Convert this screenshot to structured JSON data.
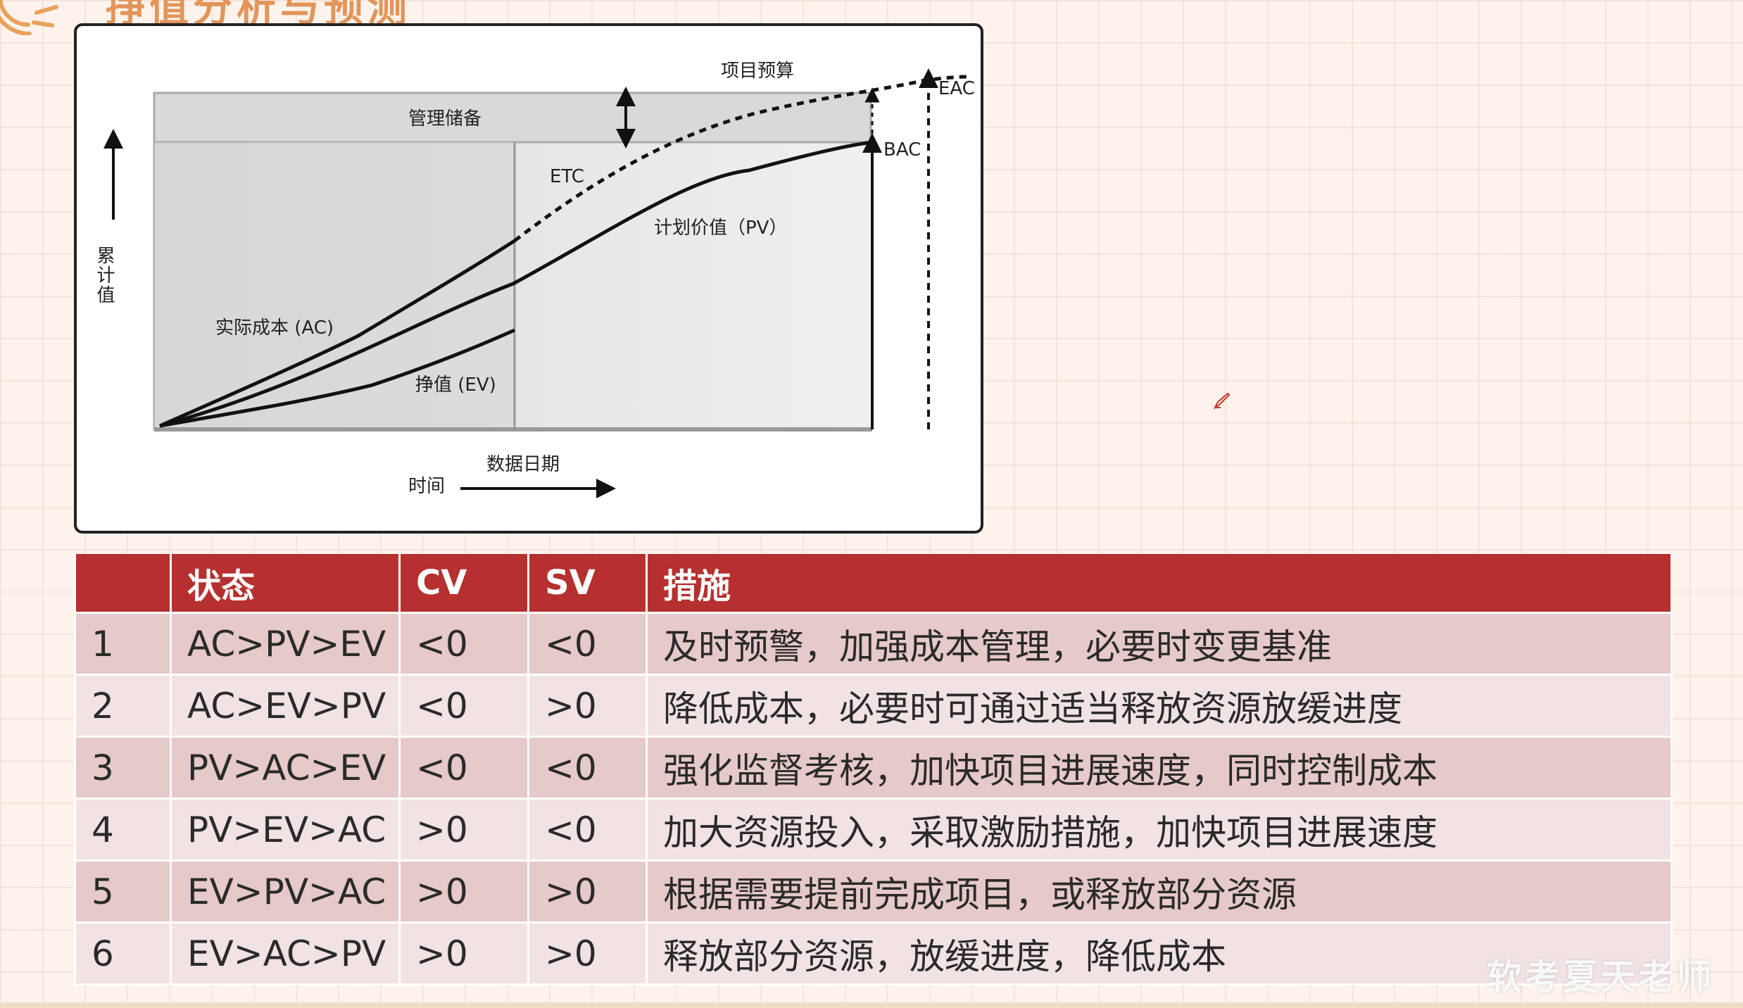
{
  "slide": {
    "title_fragment": "挣值分析与预测",
    "watermark": "软考夏天老师"
  },
  "diagram": {
    "labels": {
      "project_budget": "项目预算",
      "management_reserve": "管理储备",
      "eac": "EAC",
      "bac": "BAC",
      "etc": "ETC",
      "pv": "计划价值（PV）",
      "ac": "实际成本 (AC)",
      "ev": "挣值 (EV)",
      "y_axis": "累计值",
      "time": "时间",
      "data_date": "数据日期"
    }
  },
  "table": {
    "headers": [
      "",
      "状态",
      "CV",
      "SV",
      "措施"
    ],
    "rows": [
      [
        "1",
        "AC>PV>EV",
        "<0",
        "<0",
        "及时预警，加强成本管理，必要时变更基准"
      ],
      [
        "2",
        "AC>EV>PV",
        "<0",
        ">0",
        "降低成本，必要时可通过适当释放资源放缓进度"
      ],
      [
        "3",
        "PV>AC>EV",
        "<0",
        "<0",
        "强化监督考核，加快项目进展速度，同时控制成本"
      ],
      [
        "4",
        "PV>EV>AC",
        ">0",
        "<0",
        "加大资源投入，采取激励措施，加快项目进展速度"
      ],
      [
        "5",
        "EV>PV>AC",
        ">0",
        ">0",
        "根据需要提前完成项目，或释放部分资源"
      ],
      [
        "6",
        "EV>AC>PV",
        ">0",
        ">0",
        "释放部分资源，放缓进度，降低成本"
      ]
    ]
  },
  "colors": {
    "header_bg": "#b5302f",
    "row_odd": "#e6c9c9",
    "row_even": "#f1e3e3",
    "accent": "#e2955a"
  }
}
